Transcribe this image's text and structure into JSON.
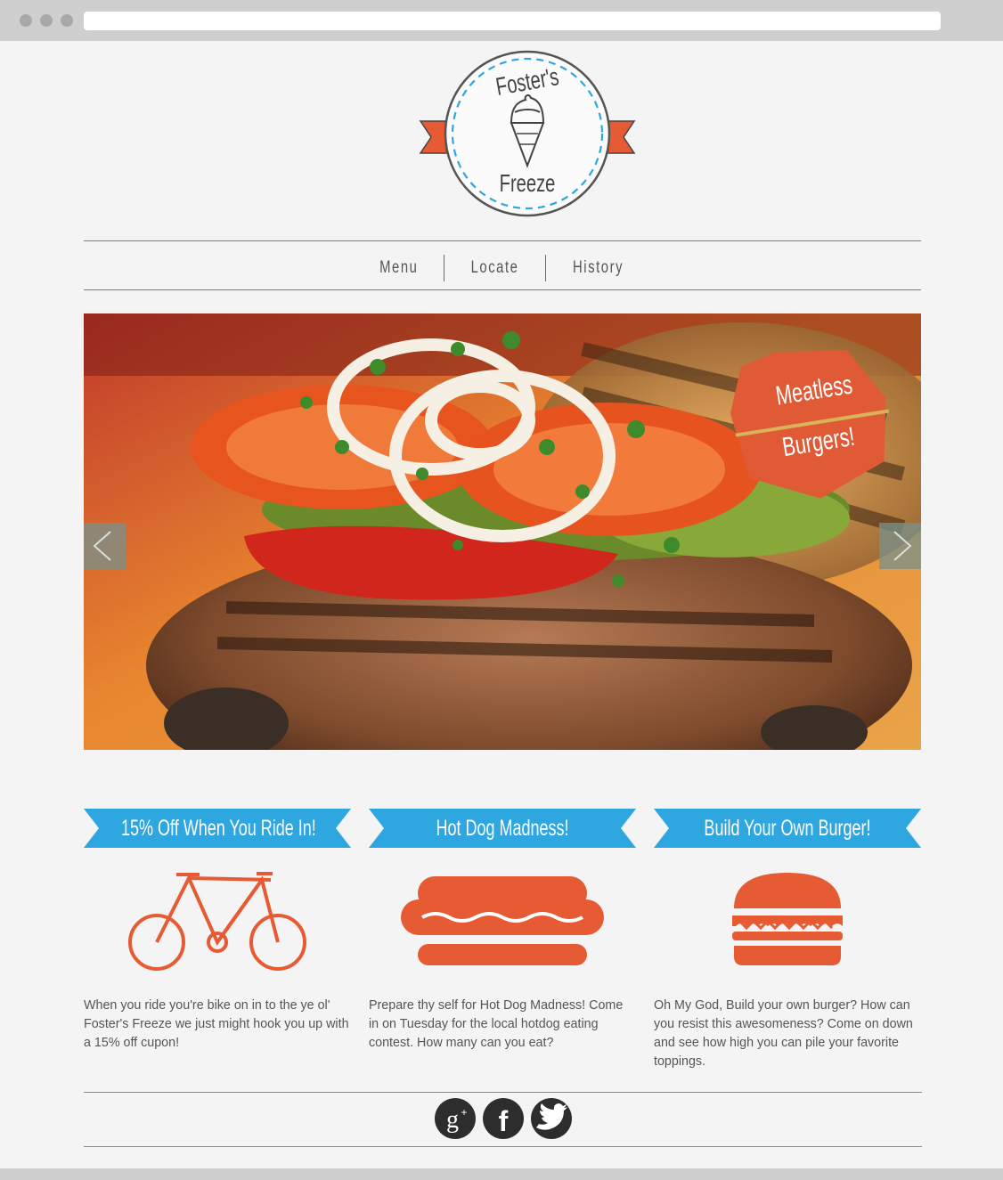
{
  "logo": {
    "line1": "Foster's",
    "line2": "Freeze"
  },
  "nav": {
    "items": [
      "Menu",
      "Locate",
      "History"
    ]
  },
  "hero": {
    "badge_line1": "Meatless",
    "badge_line2": "Burgers!"
  },
  "features": [
    {
      "title": "15% Off When You Ride In!",
      "icon": "bicycle-icon",
      "text": "When you ride you're bike on in to the ye ol' Foster's Freeze we just might hook you up with a 15% off cupon!"
    },
    {
      "title": "Hot Dog Madness!",
      "icon": "hot-dog-icon",
      "text": "Prepare thy self for Hot Dog Madness! Come in on Tuesday for the local hotdog eating contest. How many can you eat?"
    },
    {
      "title": "Build Your Own Burger!",
      "icon": "burger-icon",
      "text": "Oh My God, Build your own burger? How can you resist this awesomeness? Come on down and see how high you can pile your favorite toppings."
    }
  ],
  "social": [
    "google-plus-icon",
    "facebook-icon",
    "twitter-icon"
  ],
  "colors": {
    "accent_orange": "#e65a34",
    "ribbon_blue": "#2ea6e0",
    "dark": "#2d2d2d"
  }
}
